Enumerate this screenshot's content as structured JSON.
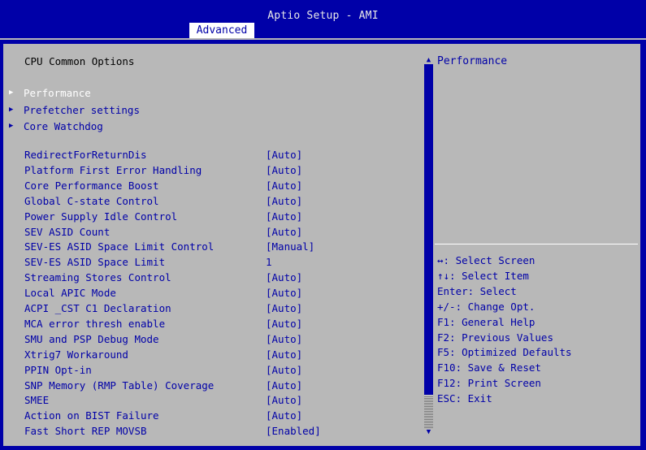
{
  "header": {
    "title": "Aptio Setup - AMI",
    "active_tab": "Advanced"
  },
  "left": {
    "section_heading": "CPU Common Options",
    "submenus": [
      {
        "label": "Performance",
        "selected": true
      },
      {
        "label": "Prefetcher settings",
        "selected": false
      },
      {
        "label": "Core Watchdog",
        "selected": false
      }
    ],
    "settings": [
      {
        "label": "RedirectForReturnDis",
        "value": "[Auto]"
      },
      {
        "label": "Platform First Error Handling",
        "value": "[Auto]"
      },
      {
        "label": "Core Performance Boost",
        "value": "[Auto]"
      },
      {
        "label": "Global C-state Control",
        "value": "[Auto]"
      },
      {
        "label": "Power Supply Idle Control",
        "value": "[Auto]"
      },
      {
        "label": "SEV ASID Count",
        "value": "[Auto]"
      },
      {
        "label": "SEV-ES ASID Space Limit Control",
        "value": "[Manual]"
      },
      {
        "label": "SEV-ES ASID Space Limit",
        "value": "1"
      },
      {
        "label": "Streaming Stores Control",
        "value": "[Auto]"
      },
      {
        "label": "Local APIC Mode",
        "value": "[Auto]"
      },
      {
        "label": "ACPI _CST C1 Declaration",
        "value": "[Auto]"
      },
      {
        "label": "MCA error thresh enable",
        "value": "[Auto]"
      },
      {
        "label": "SMU and PSP Debug Mode",
        "value": "[Auto]"
      },
      {
        "label": "Xtrig7 Workaround",
        "value": "[Auto]"
      },
      {
        "label": "PPIN Opt-in",
        "value": "[Auto]"
      },
      {
        "label": "SNP Memory (RMP Table) Coverage",
        "value": "[Auto]"
      },
      {
        "label": "SMEE",
        "value": "[Auto]"
      },
      {
        "label": "Action on BIST Failure",
        "value": "[Auto]"
      },
      {
        "label": "Fast Short REP MOVSB",
        "value": "[Enabled]"
      }
    ]
  },
  "help": {
    "description": "Performance",
    "keys": [
      "↔: Select Screen",
      "↑↓: Select Item",
      "Enter: Select",
      "+/-: Change Opt.",
      "F1: General Help",
      "F2: Previous Values",
      "F5: Optimized Defaults",
      "F10: Save & Reset",
      "F12: Print Screen",
      "ESC: Exit"
    ]
  },
  "scrollbar": {
    "up_arrow": "▲",
    "down_arrow": "▼"
  },
  "colors": {
    "background": "#0000a8",
    "panel": "#b8b8b8",
    "text": "#0000a8",
    "selected_text": "#ffffff"
  }
}
